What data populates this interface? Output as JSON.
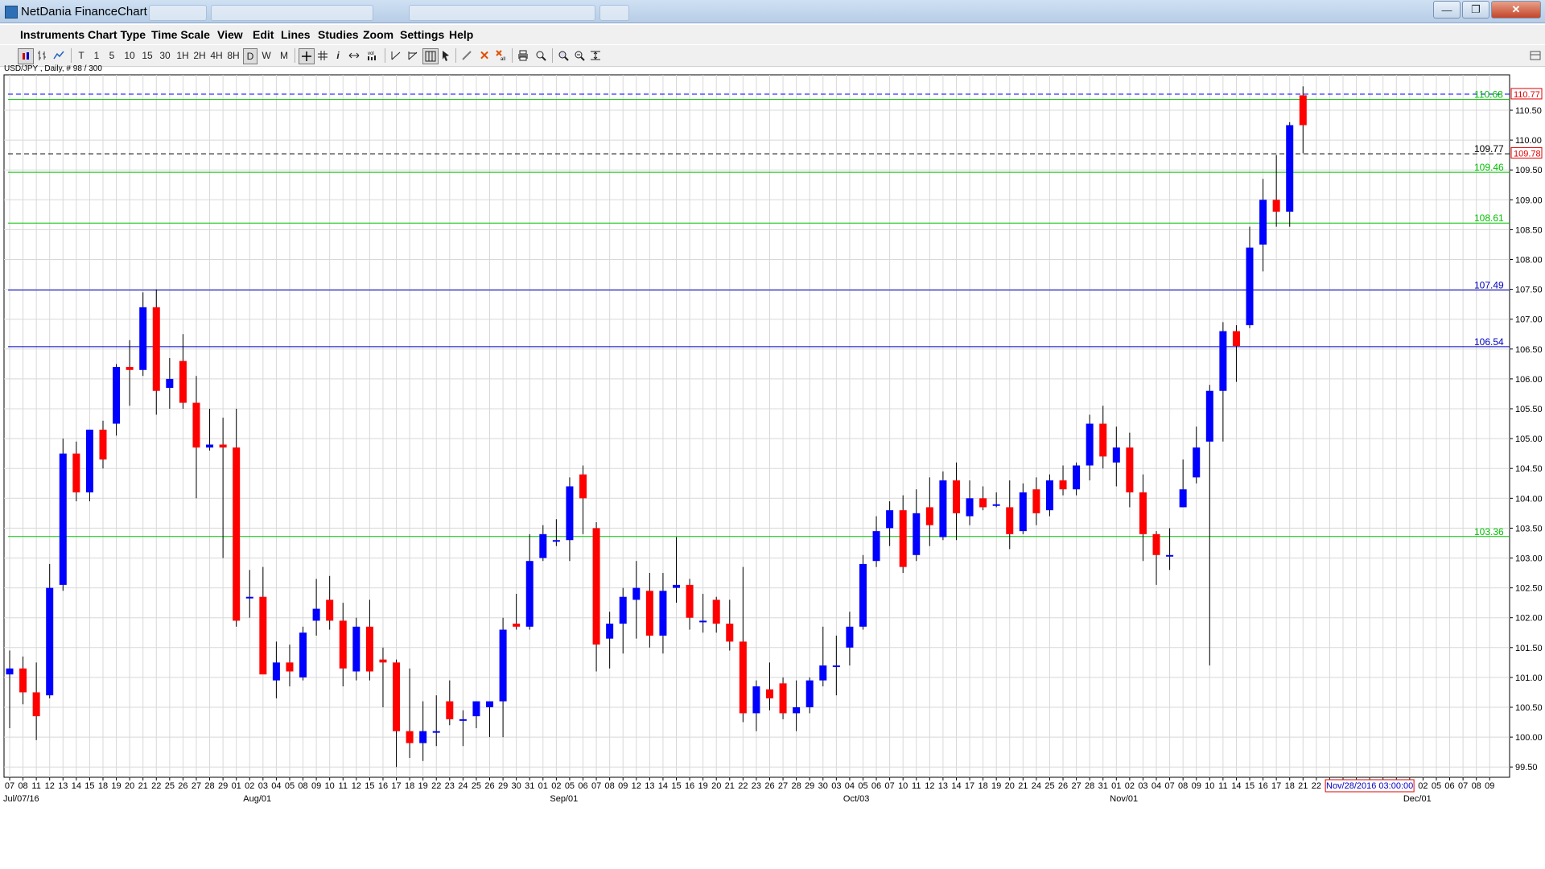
{
  "window": {
    "title": "NetDania FinanceChart",
    "buttons": {
      "minimize": "—",
      "maximize": "❐",
      "close": "✕"
    }
  },
  "menu": [
    "Instruments",
    "Chart Type",
    "Time Scale",
    "View",
    "Edit",
    "Lines",
    "Studies",
    "Zoom",
    "Settings",
    "Help"
  ],
  "toolbar": {
    "periods": [
      "T",
      "1",
      "5",
      "10",
      "15",
      "30",
      "1H",
      "2H",
      "4H",
      "8H",
      "D",
      "W",
      "M"
    ],
    "active_period": "D",
    "icons": [
      "candle-icon",
      "ohlc-icon",
      "line-icon",
      "crosshair-icon",
      "grid-icon",
      "info-icon",
      "pan-icon",
      "volume-icon",
      "trendline-icon",
      "fibonacci-icon",
      "grid-select-icon",
      "pointer-icon",
      "draw-icon",
      "delete-icon",
      "delete-all-icon",
      "print-icon",
      "zoom-window-icon",
      "zoom-in-icon",
      "zoom-fit-icon"
    ]
  },
  "instrument_label": "USD/JPY , Daily, # 98 / 300",
  "chart_data": {
    "type": "candlestick",
    "symbol": "USD/JPY",
    "ylim": [
      99.3,
      111.5
    ],
    "y_ticks": [
      "110.50",
      "110.00",
      "109.50",
      "109.00",
      "108.50",
      "108.00",
      "107.50",
      "107.00",
      "106.50",
      "106.00",
      "105.50",
      "105.00",
      "104.50",
      "104.00",
      "103.50",
      "103.00",
      "102.50",
      "102.00",
      "101.50",
      "101.00",
      "100.50",
      "100.00",
      "99.50"
    ],
    "x_labels": [
      "07",
      "08",
      "11",
      "12",
      "13",
      "14",
      "15",
      "18",
      "19",
      "20",
      "21",
      "22",
      "25",
      "26",
      "27",
      "28",
      "29",
      "01",
      "02",
      "03",
      "04",
      "05",
      "08",
      "09",
      "10",
      "11",
      "12",
      "15",
      "16",
      "17",
      "18",
      "19",
      "22",
      "23",
      "24",
      "25",
      "26",
      "29",
      "30",
      "31",
      "01",
      "02",
      "05",
      "06",
      "07",
      "08",
      "09",
      "12",
      "13",
      "14",
      "15",
      "16",
      "19",
      "20",
      "21",
      "22",
      "23",
      "26",
      "27",
      "28",
      "29",
      "30",
      "03",
      "04",
      "05",
      "06",
      "07",
      "10",
      "11",
      "12",
      "13",
      "14",
      "17",
      "18",
      "19",
      "20",
      "21",
      "24",
      "25",
      "26",
      "27",
      "28",
      "31",
      "01",
      "02",
      "03",
      "04",
      "07",
      "08",
      "09",
      "10",
      "11",
      "14",
      "15",
      "16",
      "17",
      "18",
      "21",
      "22",
      "23",
      "24",
      "25",
      "28",
      "29",
      "30",
      "01",
      "02",
      "05",
      "06",
      "07",
      "08",
      "09"
    ],
    "month_labels": [
      {
        "text": "Jul/07/16",
        "index": 0
      },
      {
        "text": "Aug/01",
        "index": 18
      },
      {
        "text": "Sep/01",
        "index": 41
      },
      {
        "text": "Oct/03",
        "index": 63
      },
      {
        "text": "Nov/01",
        "index": 83
      },
      {
        "text": "Dec/01",
        "index": 105
      }
    ],
    "crosshair_date": "Nov/28/2016 03:00:00",
    "crosshair_index": 102,
    "candles": [
      [
        101.05,
        101.45,
        100.15,
        101.15
      ],
      [
        101.15,
        101.35,
        100.55,
        100.75
      ],
      [
        100.75,
        101.25,
        99.95,
        100.35
      ],
      [
        100.7,
        102.9,
        100.65,
        102.5
      ],
      [
        102.55,
        105.0,
        102.45,
        104.75
      ],
      [
        104.75,
        104.95,
        103.95,
        104.1
      ],
      [
        104.1,
        105.15,
        103.95,
        105.15
      ],
      [
        105.15,
        105.3,
        104.5,
        104.65
      ],
      [
        105.25,
        106.25,
        105.05,
        106.2
      ],
      [
        106.2,
        106.65,
        105.55,
        106.15
      ],
      [
        106.15,
        107.45,
        106.05,
        107.2
      ],
      [
        107.2,
        107.5,
        105.4,
        105.8
      ],
      [
        105.85,
        106.35,
        105.5,
        106.0
      ],
      [
        106.3,
        106.75,
        105.5,
        105.6
      ],
      [
        105.6,
        106.05,
        104.0,
        104.85
      ],
      [
        104.85,
        105.5,
        104.8,
        104.9
      ],
      [
        104.9,
        105.35,
        103.0,
        104.85
      ],
      [
        104.85,
        105.5,
        101.85,
        101.95
      ],
      [
        102.35,
        102.8,
        102.0,
        102.35
      ],
      [
        102.35,
        102.85,
        101.1,
        101.05
      ],
      [
        100.95,
        101.6,
        100.65,
        101.25
      ],
      [
        101.25,
        101.55,
        100.85,
        101.1
      ],
      [
        101.0,
        101.85,
        100.95,
        101.75
      ],
      [
        101.95,
        102.65,
        101.7,
        102.15
      ],
      [
        102.3,
        102.7,
        101.8,
        101.95
      ],
      [
        101.95,
        102.25,
        100.85,
        101.15
      ],
      [
        101.1,
        102.0,
        100.95,
        101.85
      ],
      [
        101.85,
        102.3,
        100.95,
        101.1
      ],
      [
        101.3,
        101.5,
        100.5,
        101.25
      ],
      [
        101.25,
        101.3,
        99.5,
        100.1
      ],
      [
        100.1,
        101.15,
        99.65,
        99.9
      ],
      [
        99.9,
        100.6,
        99.6,
        100.1
      ],
      [
        100.1,
        100.7,
        99.85,
        100.1
      ],
      [
        100.6,
        100.95,
        100.2,
        100.3
      ],
      [
        100.3,
        100.45,
        99.85,
        100.3
      ],
      [
        100.35,
        100.6,
        100.15,
        100.6
      ],
      [
        100.5,
        100.6,
        100.0,
        100.6
      ],
      [
        100.6,
        102.0,
        100.0,
        101.8
      ],
      [
        101.9,
        102.4,
        101.8,
        101.85
      ],
      [
        101.85,
        103.4,
        101.8,
        102.95
      ],
      [
        103.0,
        103.55,
        102.95,
        103.4
      ],
      [
        103.3,
        103.65,
        103.2,
        103.3
      ],
      [
        103.3,
        104.35,
        102.95,
        104.2
      ],
      [
        104.4,
        104.55,
        103.4,
        104.0
      ],
      [
        103.5,
        103.6,
        101.1,
        101.55
      ],
      [
        101.65,
        102.1,
        101.15,
        101.9
      ],
      [
        101.9,
        102.5,
        101.4,
        102.35
      ],
      [
        102.3,
        102.95,
        101.65,
        102.5
      ],
      [
        102.45,
        102.75,
        101.5,
        101.7
      ],
      [
        101.7,
        102.75,
        101.4,
        102.45
      ],
      [
        102.5,
        103.35,
        102.25,
        102.55
      ],
      [
        102.55,
        102.65,
        101.8,
        102.0
      ],
      [
        101.95,
        102.4,
        101.75,
        101.95
      ],
      [
        102.3,
        102.35,
        101.75,
        101.9
      ],
      [
        101.9,
        102.3,
        101.45,
        101.6
      ],
      [
        101.6,
        102.85,
        100.25,
        100.4
      ],
      [
        100.4,
        100.95,
        100.1,
        100.85
      ],
      [
        100.8,
        101.25,
        100.45,
        100.65
      ],
      [
        100.9,
        101.0,
        100.3,
        100.4
      ],
      [
        100.4,
        100.95,
        100.1,
        100.5
      ],
      [
        100.5,
        101.0,
        100.4,
        100.95
      ],
      [
        100.95,
        101.85,
        100.85,
        101.2
      ],
      [
        101.2,
        101.7,
        100.7,
        101.2
      ],
      [
        101.5,
        102.1,
        101.2,
        101.85
      ],
      [
        101.85,
        103.05,
        101.8,
        102.9
      ],
      [
        102.95,
        103.7,
        102.85,
        103.45
      ],
      [
        103.5,
        103.95,
        103.2,
        103.8
      ],
      [
        103.8,
        104.05,
        102.75,
        102.85
      ],
      [
        103.05,
        104.15,
        102.95,
        103.75
      ],
      [
        103.85,
        104.35,
        103.2,
        103.55
      ],
      [
        103.35,
        104.45,
        103.3,
        104.3
      ],
      [
        104.3,
        104.6,
        103.3,
        103.75
      ],
      [
        103.7,
        104.3,
        103.55,
        104.0
      ],
      [
        104.0,
        104.2,
        103.8,
        103.85
      ],
      [
        103.9,
        104.1,
        103.85,
        103.9
      ],
      [
        103.85,
        104.3,
        103.15,
        103.4
      ],
      [
        103.45,
        104.25,
        103.4,
        104.1
      ],
      [
        104.15,
        104.35,
        103.55,
        103.75
      ],
      [
        103.8,
        104.4,
        103.7,
        104.3
      ],
      [
        104.3,
        104.55,
        104.05,
        104.15
      ],
      [
        104.15,
        104.6,
        104.05,
        104.55
      ],
      [
        104.55,
        105.4,
        104.3,
        105.25
      ],
      [
        105.25,
        105.55,
        104.5,
        104.7
      ],
      [
        104.6,
        105.2,
        104.2,
        104.85
      ],
      [
        104.85,
        105.1,
        103.85,
        104.1
      ],
      [
        104.1,
        104.4,
        102.95,
        103.4
      ],
      [
        103.4,
        103.45,
        102.55,
        103.05
      ],
      [
        103.05,
        103.5,
        102.8,
        103.05
      ],
      [
        103.85,
        104.65,
        103.85,
        104.15
      ],
      [
        104.35,
        105.2,
        104.25,
        104.85
      ],
      [
        104.95,
        105.9,
        101.2,
        105.8
      ],
      [
        105.8,
        106.95,
        104.95,
        106.8
      ],
      [
        106.8,
        106.9,
        105.95,
        106.55
      ],
      [
        106.9,
        108.55,
        106.85,
        108.2
      ],
      [
        108.25,
        109.35,
        107.8,
        109.0
      ],
      [
        109.0,
        109.75,
        108.55,
        108.8
      ],
      [
        108.8,
        110.3,
        108.55,
        110.25
      ],
      [
        110.75,
        110.9,
        109.78,
        110.25
      ]
    ],
    "horizontal_lines": [
      {
        "value": 110.77,
        "label": "",
        "color": "#0000ff",
        "style": "dashed"
      },
      {
        "value": 110.68,
        "label": "110.68",
        "color": "#00c000",
        "style": "solid"
      },
      {
        "value": 109.77,
        "label": "109.77",
        "color": "#000000",
        "style": "dashed"
      },
      {
        "value": 109.46,
        "label": "109.46",
        "color": "#00c000",
        "style": "solid"
      },
      {
        "value": 108.61,
        "label": "108.61",
        "color": "#00c000",
        "style": "solid"
      },
      {
        "value": 107.49,
        "label": "107.49",
        "color": "#0000c0",
        "style": "solid"
      },
      {
        "value": 106.54,
        "label": "106.54",
        "color": "#0000c0",
        "style": "solid"
      },
      {
        "value": 103.36,
        "label": "103.36",
        "color": "#00c000",
        "style": "solid"
      }
    ],
    "price_flags": [
      {
        "value": 110.77,
        "label": "110.77",
        "color": "#e00000"
      },
      {
        "value": 109.78,
        "label": "109.78",
        "color": "#e00000"
      }
    ],
    "colors": {
      "up": "#0000ff",
      "down": "#ff0000",
      "grid": "#d8d8d8",
      "wick": "#000000"
    }
  }
}
